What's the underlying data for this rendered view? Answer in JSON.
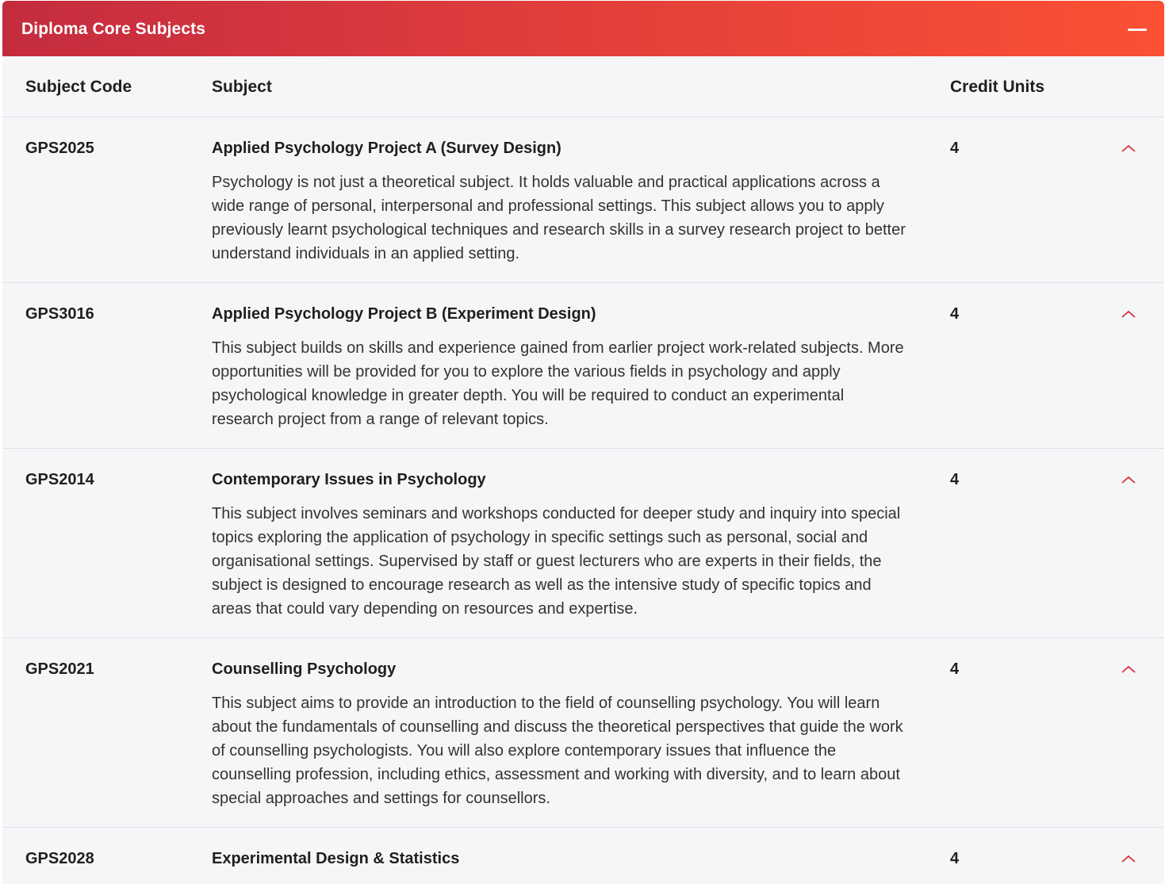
{
  "panel": {
    "title": "Diploma Core Subjects",
    "collapse_icon": "minus-icon",
    "header_gradient": [
      "#c42c3e",
      "#fb5033"
    ]
  },
  "table": {
    "headers": {
      "code": "Subject Code",
      "subject": "Subject",
      "credit": "Credit Units"
    },
    "rows": [
      {
        "code": "GPS2025",
        "title": "Applied Psychology Project A (Survey Design)",
        "description": "Psychology is not just a theoretical subject. It holds valuable and practical applications across a wide range of personal, interpersonal and professional settings. This subject allows you to apply previously learnt psychological techniques and research skills in a survey research project to better understand individuals in an applied setting.",
        "credit": "4",
        "toggle_icon": "chevron-up-icon"
      },
      {
        "code": "GPS3016",
        "title": "Applied Psychology Project B (Experiment Design)",
        "description": "This subject builds on skills and experience gained from earlier project work-related subjects. More opportunities will be provided for you to explore the various fields in psychology and apply psychological knowledge in greater depth. You will be required to conduct an experimental research project from a range of relevant topics.",
        "credit": "4",
        "toggle_icon": "chevron-up-icon"
      },
      {
        "code": "GPS2014",
        "title": "Contemporary Issues in Psychology",
        "description": "This subject involves seminars and workshops conducted for deeper study and inquiry into special topics exploring the application of psychology in specific settings such as personal, social and organisational settings. Supervised by staff or guest lecturers who are experts in their fields, the subject is designed to encourage research as well as the intensive study of specific topics and areas that could vary depending on resources and expertise.",
        "credit": "4",
        "toggle_icon": "chevron-up-icon"
      },
      {
        "code": "GPS2021",
        "title": "Counselling Psychology",
        "description": "This subject aims to provide an introduction to the field of counselling psychology. You will learn about the fundamentals of counselling and discuss the theoretical perspectives that guide the work of counselling psychologists. You will also explore contemporary issues that influence the counselling profession, including ethics, assessment and working with diversity, and to learn about special approaches and settings for counsellors.",
        "credit": "4",
        "toggle_icon": "chevron-up-icon"
      },
      {
        "code": "GPS2028",
        "title": "Experimental Design & Statistics",
        "description": "",
        "credit": "4",
        "toggle_icon": "chevron-up-icon"
      }
    ]
  },
  "colors": {
    "accent": "#e0303e",
    "row_background": "#f5f6f8",
    "divider": "#dfe1e5"
  }
}
